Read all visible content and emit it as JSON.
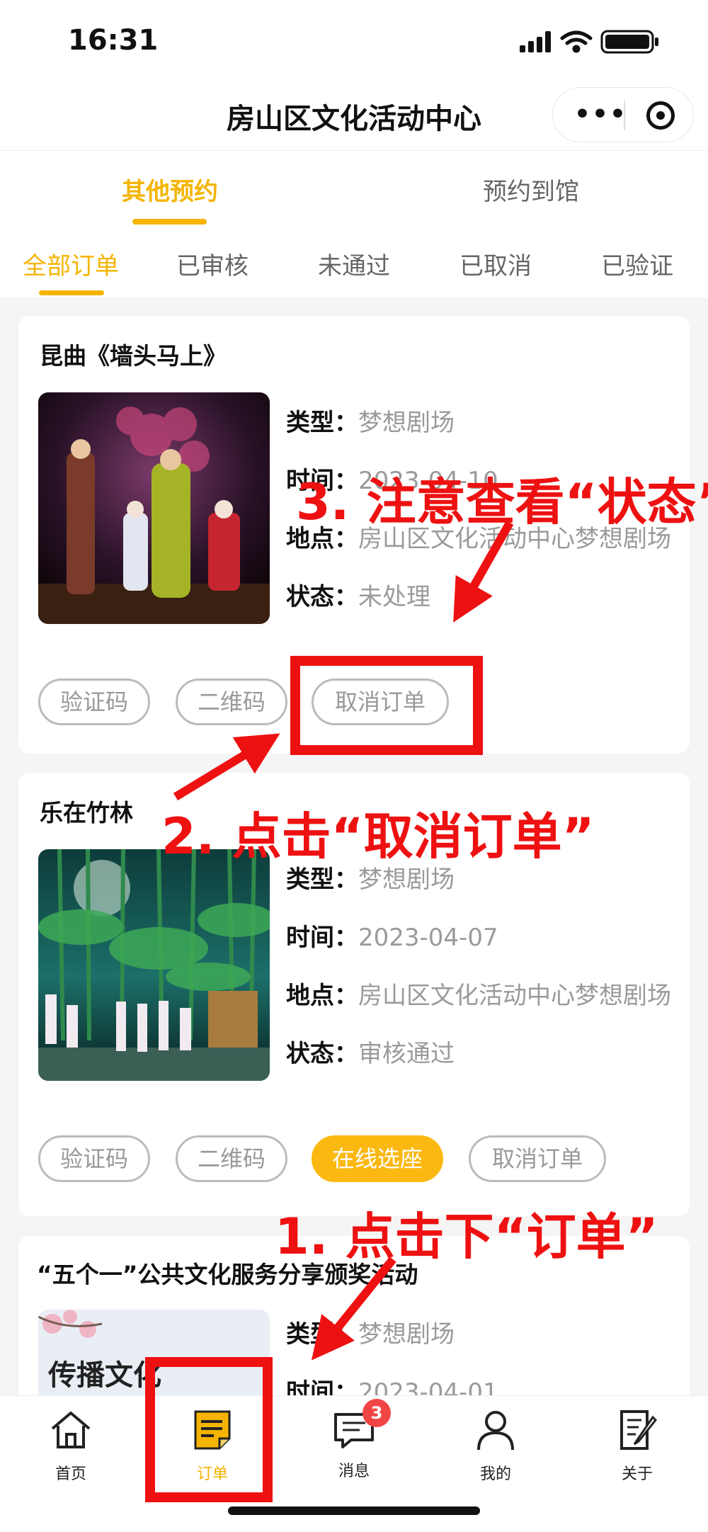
{
  "status_bar": {
    "time": "16:31"
  },
  "nav": {
    "title": "房山区文化活动中心",
    "more_icon": "more-dots-icon",
    "close_icon": "target-circle-icon"
  },
  "top_tabs": [
    "其他预约",
    "预约到馆"
  ],
  "sub_tabs": [
    "全部订单",
    "已审核",
    "未通过",
    "已取消",
    "已验证"
  ],
  "labels": {
    "type": "类型：",
    "time": "时间：",
    "place": "地点：",
    "status": "状态："
  },
  "cards": [
    {
      "title": "昆曲《墙头马上》",
      "type": "梦想剧场",
      "time": "2023-04-10",
      "place": "房山区文化活动中心梦想剧场",
      "status": "未处理",
      "buttons": [
        "验证码",
        "二维码",
        "取消订单"
      ]
    },
    {
      "title": "乐在竹林",
      "type": "梦想剧场",
      "time": "2023-04-07",
      "place": "房山区文化活动中心梦想剧场",
      "status": "审核通过",
      "buttons": [
        "验证码",
        "二维码",
        "在线选座",
        "取消订单"
      ]
    },
    {
      "title": "“五个一”公共文化服务分享颁奖活动",
      "type": "梦想剧场",
      "time": "2023-04-01",
      "poster_text": "传播文化"
    }
  ],
  "tab_bar": [
    {
      "label": "首页",
      "icon": "home-icon"
    },
    {
      "label": "订单",
      "icon": "order-icon",
      "active": true
    },
    {
      "label": "消息",
      "icon": "message-icon",
      "badge": "3"
    },
    {
      "label": "我的",
      "icon": "user-icon"
    },
    {
      "label": "关于",
      "icon": "about-icon"
    }
  ],
  "annotations": {
    "step1": "1. 点击下“订单”",
    "step2": "2. 点击“取消订单”",
    "step3": "3. 注意查看“状态”"
  },
  "colors": {
    "accent": "#f5b400",
    "annotation": "#ee1111",
    "badge": "#f14545"
  }
}
